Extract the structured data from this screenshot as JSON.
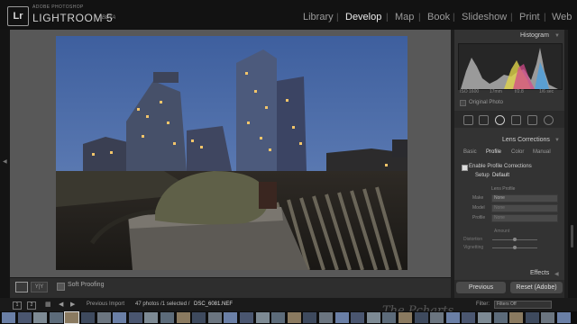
{
  "app": {
    "logo": "Lr",
    "brand_sub": "ADOBE PHOTOSHOP",
    "brand_name": "LIGHTROOM 5",
    "brand_tag": "BETA"
  },
  "modules": [
    {
      "label": "Library",
      "active": false
    },
    {
      "label": "Develop",
      "active": true
    },
    {
      "label": "Map",
      "active": false
    },
    {
      "label": "Book",
      "active": false
    },
    {
      "label": "Slideshow",
      "active": false
    },
    {
      "label": "Print",
      "active": false
    },
    {
      "label": "Web",
      "active": false
    }
  ],
  "toolbar": {
    "view_btn": "Y|Y",
    "soft_proofing": "Soft Proofing"
  },
  "panels": {
    "histogram": {
      "title": "Histogram",
      "iso": "ISO 1600",
      "focal": "17mm",
      "aperture": "f/2.8",
      "shutter": "1/6 sec",
      "original_photo": "Original Photo"
    },
    "lens_corrections": {
      "title": "Lens Corrections",
      "tabs": [
        {
          "label": "Basic",
          "active": false
        },
        {
          "label": "Profile",
          "active": true
        },
        {
          "label": "Color",
          "active": false
        },
        {
          "label": "Manual",
          "active": false
        }
      ],
      "enable_label": "Enable Profile Corrections",
      "setup_label": "Setup",
      "setup_value": "Default",
      "lens_profile_label": "Lens Profile",
      "make_label": "Make",
      "make_value": "None",
      "model_label": "Model",
      "model_value": "None",
      "profile_label": "Profile",
      "profile_value": "None",
      "amount_label": "Amount",
      "distortion_label": "Distortion",
      "vignetting_label": "Vignetting"
    },
    "effects": {
      "title": "Effects"
    }
  },
  "buttons": {
    "previous": "Previous",
    "reset": "Reset (Adobe)"
  },
  "filmstrip": {
    "box1": "1",
    "box2": "2",
    "previous_import": "Previous Import",
    "count": "47 photos /1 selected /",
    "filename": "DSC_6081.NEF",
    "filter_label": "Filter:",
    "filter_value": "Filters Off",
    "watermark": "The Pcharts"
  },
  "colors": {
    "accent_active": "#ececec",
    "panel_bg": "#333333",
    "canvas_bg": "#585858"
  }
}
